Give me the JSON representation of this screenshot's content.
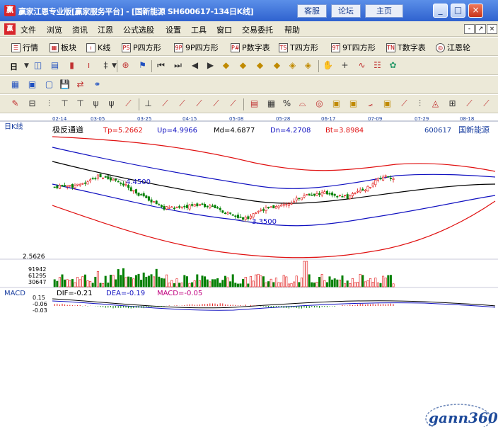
{
  "window": {
    "logo": "赢",
    "title": "赢家江恩专业版[赢家服务平台] - [国新能源  SH600617-134日K线]",
    "buttons": [
      "客服",
      "论坛",
      "主页"
    ],
    "controls": [
      "_",
      "□",
      "×"
    ]
  },
  "menu": {
    "logo": "赢",
    "items": [
      "文件",
      "浏览",
      "资讯",
      "江恩",
      "公式选股",
      "设置",
      "工具",
      "窗口",
      "交易委托",
      "帮助"
    ],
    "controls": [
      "-",
      "↗",
      "×"
    ]
  },
  "toolbar1": [
    {
      "label": "行情",
      "icon": "quote-icon",
      "glyph": "☰"
    },
    {
      "label": "板块",
      "icon": "sector-icon",
      "glyph": "▦"
    },
    {
      "label": "K线",
      "icon": "kline-icon",
      "glyph": "ı"
    },
    {
      "label": "P四方形",
      "icon": "p-square-icon",
      "glyph": "PS"
    },
    {
      "label": "9P四方形",
      "icon": "9p-square-icon",
      "glyph": "9P"
    },
    {
      "label": "P数字表",
      "icon": "p-table-icon",
      "glyph": "P#"
    },
    {
      "label": "T四方形",
      "icon": "t-square-icon",
      "glyph": "TS"
    },
    {
      "label": "9T四方形",
      "icon": "9t-square-icon",
      "glyph": "9T"
    },
    {
      "label": "T数字表",
      "icon": "t-table-icon",
      "glyph": "TN"
    },
    {
      "label": "江恩轮",
      "icon": "gann-wheel-icon",
      "glyph": "◎"
    }
  ],
  "toolbar2": {
    "period_label": "日"
  },
  "chart": {
    "section_label": "日K线",
    "indicator": "极反通道",
    "tp": "Tp=5.2662",
    "up": "Up=4.9966",
    "md": "Md=4.6877",
    "dn": "Dn=4.2708",
    "bt": "Bt=3.8984",
    "code": "600617",
    "name": "国新能源",
    "dates": [
      "02-14",
      "03-05",
      "03-25",
      "04-15",
      "05-08",
      "05-28",
      "06-17",
      "07-09",
      "07-29",
      "08-18"
    ],
    "high_annot": "4.4500",
    "low_annot": "3.3500",
    "price_label": "2.5626",
    "volume_labels": [
      "91942",
      "61295",
      "30647"
    ],
    "macd": {
      "label": "MACD",
      "dif": "DIF=-0.21",
      "dea": "DEA=-0.19",
      "macd_value": "MACD=-0.05",
      "axis": [
        "0.15",
        "-0.06",
        "-0.03"
      ]
    },
    "colors": {
      "up": "#e01010",
      "down": "#007f00",
      "outer": "#e01010",
      "middle": "#1010c0",
      "inner": "#000000",
      "date_axis": "#1a3fa0"
    }
  },
  "watermark": "gann360"
}
